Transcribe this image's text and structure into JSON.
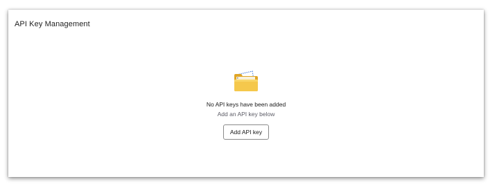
{
  "panel": {
    "title": "API Key Management"
  },
  "empty_state": {
    "icon": "folder-icon",
    "title": "No API keys have been added",
    "subtitle": "Add an API key below",
    "button_label": "Add API key"
  },
  "colors": {
    "folder_primary": "#F5C84C",
    "folder_back": "#E0A526",
    "folder_dots": "#2D6BD6"
  }
}
